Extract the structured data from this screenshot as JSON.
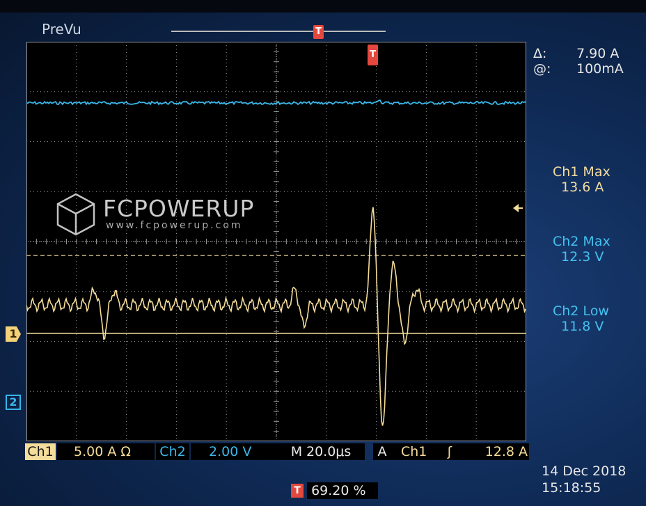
{
  "header": {
    "status": "PreVu",
    "trigger_marker_top": "T",
    "trigger_marker_plot": "T"
  },
  "watermark": {
    "name": "FCPOWERUP",
    "url": "www.fcpowerup.com"
  },
  "channel_markers": {
    "ch1": "1",
    "ch2": "2"
  },
  "cursor": {
    "delta_symbol": "Δ:",
    "delta_value": "7.90 A",
    "at_symbol": "@:",
    "at_value": "100mA"
  },
  "measurements": [
    {
      "label": "Ch1 Max",
      "value": "13.6 A",
      "color": "#f2dca0"
    },
    {
      "label": "Ch2 Max",
      "value": "12.3 V",
      "color": "#45c0ee"
    },
    {
      "label": "Ch2 Low",
      "value": "11.8 V",
      "color": "#45c0ee"
    }
  ],
  "bottom_bar": {
    "ch1_label": "Ch1",
    "ch1_scale": "5.00 A Ω",
    "ch2_label": "Ch2",
    "ch2_scale": "2.00 V",
    "timebase_label": "M",
    "timebase_value": "20.0μs",
    "trigger_mode": "A",
    "trigger_source": "Ch1",
    "trigger_slope": "ʃ",
    "trigger_level": "12.8 A"
  },
  "trigger_position": {
    "icon": "T",
    "value": "69.20 %"
  },
  "timestamp": {
    "date": "14 Dec  2018",
    "time": "15:18:55"
  },
  "colors": {
    "ch1": "#f4dc9a",
    "ch2": "#3bb7ea",
    "trigger": "#e4473d",
    "grid": "#9a9a9a"
  }
}
